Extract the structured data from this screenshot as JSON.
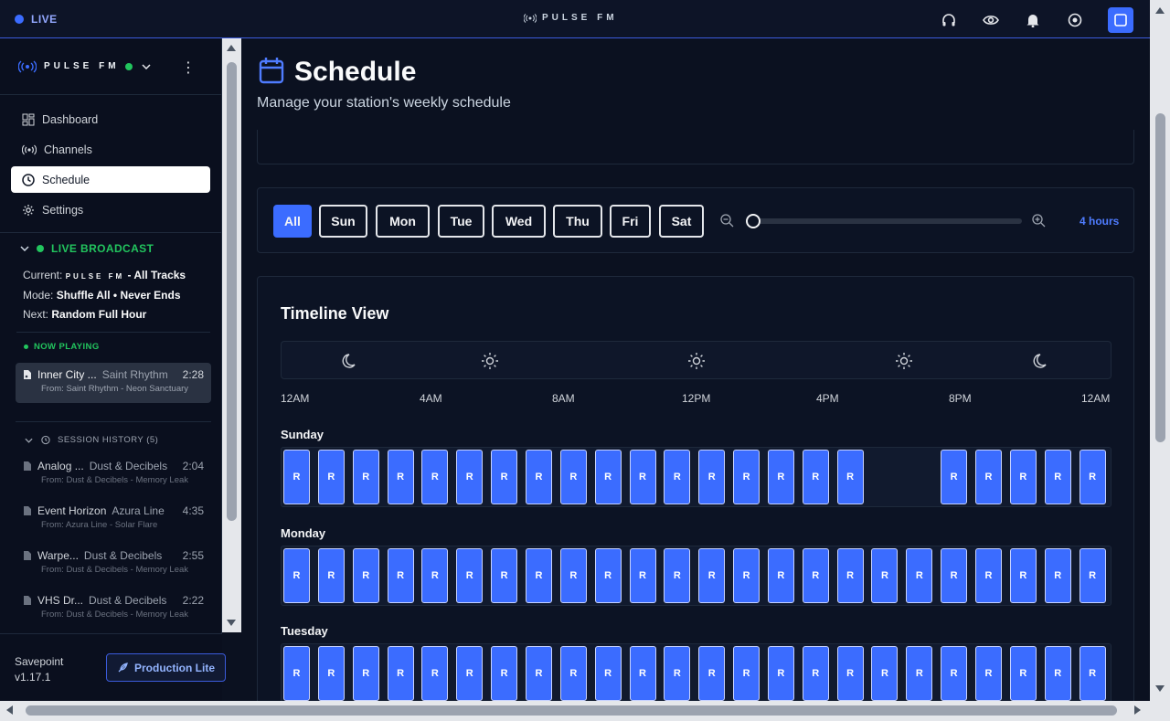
{
  "topbar": {
    "live_label": "LIVE",
    "brand": "PULSE FM",
    "icons": [
      "headphones-icon",
      "eye-icon",
      "bell-icon",
      "target-icon",
      "square-icon"
    ]
  },
  "sidebar": {
    "brand": "PULSE FM",
    "nav": [
      {
        "label": "Dashboard",
        "icon": "dashboard-icon"
      },
      {
        "label": "Channels",
        "icon": "broadcast-icon"
      },
      {
        "label": "Schedule",
        "icon": "clock-icon",
        "active": true
      },
      {
        "label": "Settings",
        "icon": "gear-icon"
      }
    ],
    "broadcast": {
      "title": "LIVE BROADCAST",
      "current_label": "Current:",
      "current_brand": "PULSE FM",
      "current_value": "- All Tracks",
      "mode_label": "Mode:",
      "mode_value": "Shuffle All • Never Ends",
      "next_label": "Next:",
      "next_value": "Random Full Hour"
    },
    "now_playing": {
      "title": "NOW PLAYING",
      "track": "Inner City ...",
      "artist": "Saint Rhythm",
      "duration": "2:28",
      "from": "From: Saint Rhythm - Neon Sanctuary"
    },
    "history": {
      "title": "SESSION HISTORY (5)",
      "items": [
        {
          "track": "Analog ...",
          "artist": "Dust & Decibels",
          "duration": "2:04",
          "from": "From: Dust & Decibels - Memory Leak"
        },
        {
          "track": "Event Horizon",
          "artist": "Azura Line",
          "duration": "4:35",
          "from": "From: Azura Line - Solar Flare"
        },
        {
          "track": "Warpe...",
          "artist": "Dust & Decibels",
          "duration": "2:55",
          "from": "From: Dust & Decibels - Memory Leak"
        },
        {
          "track": "VHS Dr...",
          "artist": "Dust & Decibels",
          "duration": "2:22",
          "from": "From: Dust & Decibels - Memory Leak"
        }
      ]
    },
    "footer": {
      "name": "Savepoint",
      "version": "v1.17.1",
      "plan_button": "Production Lite"
    }
  },
  "main": {
    "title": "Schedule",
    "subtitle": "Manage your station's weekly schedule",
    "days": [
      "All",
      "Sun",
      "Mon",
      "Tue",
      "Wed",
      "Thu",
      "Fri",
      "Sat"
    ],
    "active_day": "All",
    "zoom_value": "4 hours",
    "timeline": {
      "title": "Timeline View",
      "time_of_day_icons": [
        "moon-icon",
        "sun-icon",
        "sun-icon",
        "sun-icon",
        "moon-icon"
      ],
      "hours": [
        "12AM",
        "4AM",
        "8AM",
        "12PM",
        "4PM",
        "8PM",
        "12AM"
      ],
      "block_label": "R",
      "rows": [
        {
          "day": "Sunday",
          "blocks": 22,
          "gap_after": 17
        },
        {
          "day": "Monday",
          "blocks": 24,
          "gap_after": null
        },
        {
          "day": "Tuesday",
          "blocks": 24,
          "gap_after": null
        }
      ]
    }
  },
  "colors": {
    "accent": "#3b6cff",
    "live_green": "#22c55e",
    "background": "#0b1120"
  }
}
